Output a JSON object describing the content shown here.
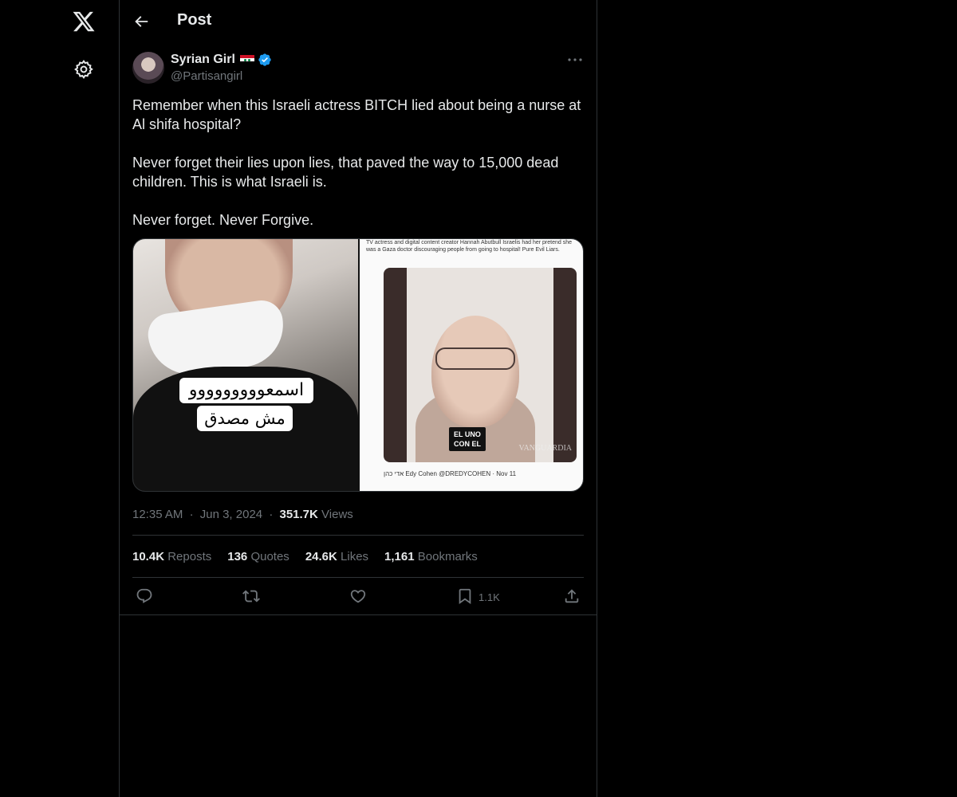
{
  "nav": {
    "logo_icon": "x-logo-icon",
    "settings_icon": "gear-icon"
  },
  "header": {
    "title": "Post",
    "back_icon": "arrow-left-icon"
  },
  "author": {
    "name": "Syrian Girl",
    "handle": "@Partisangirl",
    "verified_color": "#1d9bf0"
  },
  "tweet": {
    "text": "Remember when this Israeli actress BITCH lied about being a nurse at Al shifa hospital?\n\nNever forget their lies upon lies, that paved the way to 15,000 dead children. This is what Israeli is.\n\nNever forget. Never Forgive."
  },
  "media": {
    "left_caption_line1": "اسمعووووووووو",
    "left_caption_line2": "مش مصدق",
    "right_top_text": "TV actress and digital content creator Hannah Abutbull Israelis had her pretend she was a Gaza doctor discouraging people from going to hospital! Pure Evil Liars.",
    "right_video_badge_line1": "EL UNO",
    "right_video_badge_line2": "CON EL",
    "right_watermark": "VANGUARDIA",
    "right_bottom_text": "אדי כהן Edy Cohen @DREDYCOHEN · Nov 11"
  },
  "meta": {
    "time": "12:35 AM",
    "date": "Jun 3, 2024",
    "views_count": "351.7K",
    "views_label": "Views",
    "separator": "·"
  },
  "stats": {
    "reposts_count": "10.4K",
    "reposts_label": "Reposts",
    "quotes_count": "136",
    "quotes_label": "Quotes",
    "likes_count": "24.6K",
    "likes_label": "Likes",
    "bookmarks_count": "1,161",
    "bookmarks_label": "Bookmarks"
  },
  "actions": {
    "bookmark_count": "1.1K"
  },
  "colors": {
    "background": "#000000",
    "text": "#e7e9ea",
    "muted": "#71767b",
    "border": "#2f3336"
  }
}
